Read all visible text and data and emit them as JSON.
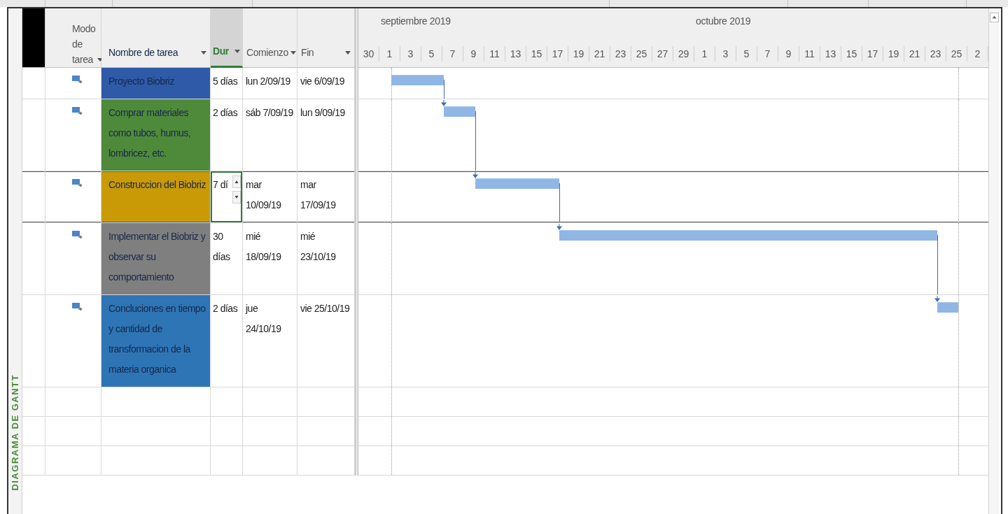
{
  "view_bar": {
    "label": "DIAGRAMA DE GANTT"
  },
  "columns": [
    {
      "label": "Modo de tarea",
      "selected": false
    },
    {
      "label": "Nombre de tarea",
      "selected": false
    },
    {
      "label": "Dur",
      "selected": true
    },
    {
      "label": "Comienzo",
      "selected": false
    },
    {
      "label": "Fin",
      "selected": false
    }
  ],
  "timeline": {
    "months": [
      {
        "label": "septiembre 2019"
      },
      {
        "label": "octubre 2019"
      }
    ],
    "days": [
      "30",
      "1",
      "3",
      "5",
      "7",
      "9",
      "11",
      "13",
      "15",
      "17",
      "19",
      "21",
      "23",
      "25",
      "27",
      "29",
      "1",
      "3",
      "5",
      "7",
      "9",
      "11",
      "13",
      "15",
      "17",
      "19",
      "21",
      "23",
      "25",
      "2"
    ]
  },
  "tasks": [
    {
      "name": "Proyecto Biobriz",
      "color": "#2e5aa8",
      "duration": "5 días",
      "start": "lun 2/09/19",
      "end": "vie 6/09/19",
      "selected": false,
      "editing": false,
      "predecessor_link": false
    },
    {
      "name": "Comprar materiales como tubos, humus, lombricez, etc.",
      "color": "#4f8a3a",
      "duration": "2 días",
      "start": "sáb 7/09/19",
      "end": "lun 9/09/19",
      "selected": false,
      "editing": false,
      "predecessor_link": true
    },
    {
      "name": "Construccion del Biobriz",
      "color": "#c99a06",
      "duration": "7 dí",
      "start": "mar 10/09/19",
      "end": "mar 17/09/19",
      "selected": true,
      "editing": true,
      "predecessor_link": true
    },
    {
      "name": "Implementar el Biobriz y observar su comportamiento",
      "color": "#7f7f7f",
      "duration": "30 días",
      "start": "mié 18/09/19",
      "end": "mié 23/10/19",
      "selected": false,
      "editing": false,
      "predecessor_link": true
    },
    {
      "name": "Concluciones en tiempo y cantidad de transformacion de la materia organica",
      "color": "#2e75b6",
      "duration": "2 días",
      "start": "jue 24/10/19",
      "end": "vie 25/10/19",
      "selected": false,
      "editing": false,
      "predecessor_link": true
    }
  ]
}
